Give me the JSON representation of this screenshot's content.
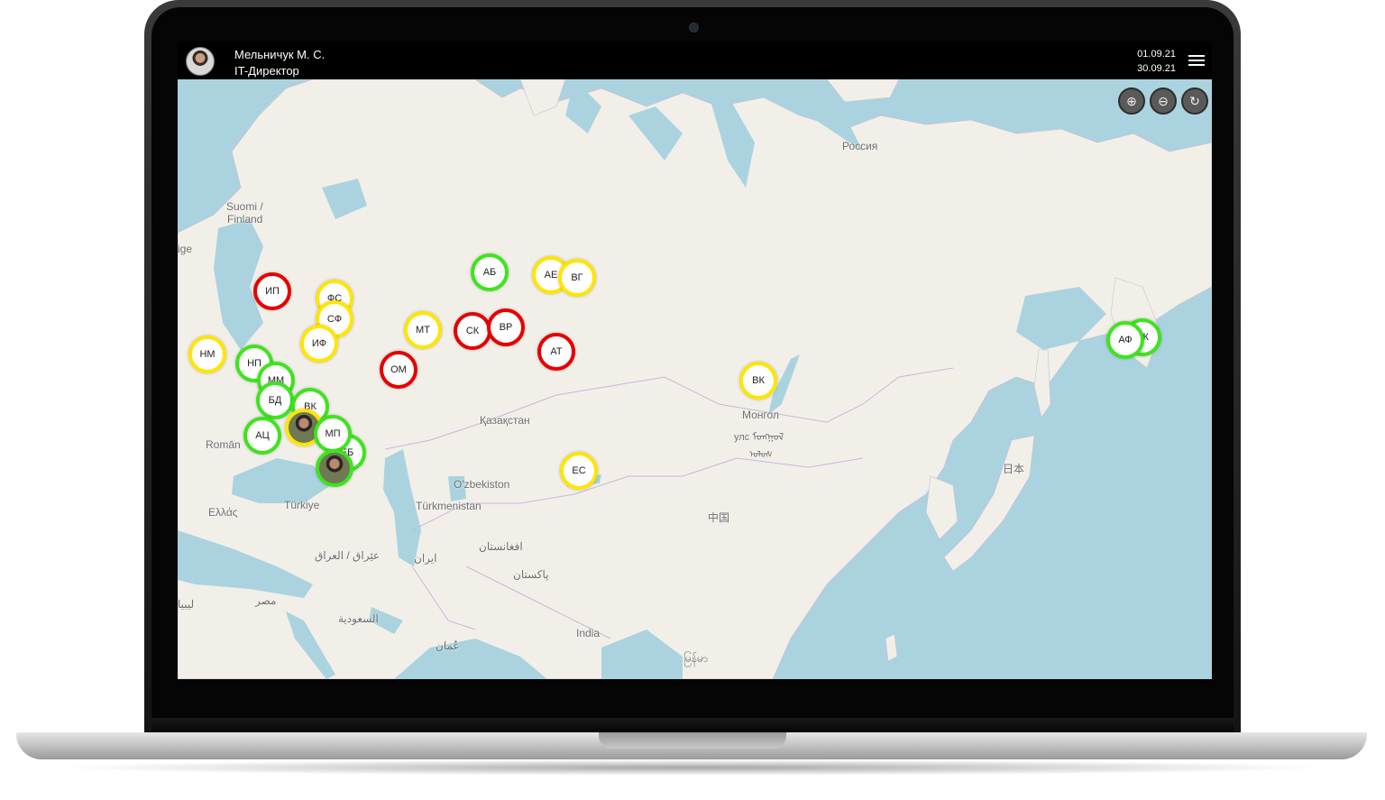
{
  "header": {
    "user_name": "Мельничук М. С.",
    "user_role": "IT-Директор",
    "date_from": "01.09.21",
    "date_to": "30.09.21"
  },
  "colors": {
    "status_red": "#e60000",
    "status_yellow": "#ffe500",
    "status_green": "#3ee41d",
    "topbar": "#000000",
    "water": "#aad3df",
    "land": "#f2efe9"
  },
  "map_controls": {
    "zoom_in_icon": "plus-circle-icon",
    "zoom_out_icon": "minus-circle-icon",
    "refresh_icon": "refresh-icon",
    "zoom_in": "⊕",
    "zoom_out": "⊖",
    "refresh": "↻"
  },
  "map_labels": [
    {
      "text": "Россия"
    },
    {
      "text": "Suomi /"
    },
    {
      "text": "Finland"
    },
    {
      "text": "ige"
    },
    {
      "text": "Romān"
    },
    {
      "text": "Ελλάς"
    },
    {
      "text": "Türkiye"
    },
    {
      "text": "Қазақстан"
    },
    {
      "text": "O'zbekiston"
    },
    {
      "text": "Türkmenistan"
    },
    {
      "text": "Монгол"
    },
    {
      "text": "улс ᠮᠣᠩᠭᠣᠯ"
    },
    {
      "text": "ᠤᠯᠤᠰ"
    },
    {
      "text": "中国"
    },
    {
      "text": "日本"
    },
    {
      "text": "عێراق / العراق"
    },
    {
      "text": "ایران"
    },
    {
      "text": "افغانستان"
    },
    {
      "text": "پاکستان"
    },
    {
      "text": "مصر"
    },
    {
      "text": "ليبيا"
    },
    {
      "text": "السعودية"
    },
    {
      "text": "عُمان"
    },
    {
      "text": "India"
    },
    {
      "text": "မြန်မာ"
    }
  ],
  "markers": [
    {
      "label": "ИП",
      "status": "red"
    },
    {
      "label": "ФС",
      "status": "yellow"
    },
    {
      "label": "СФ",
      "status": "yellow"
    },
    {
      "label": "ИФ",
      "status": "yellow"
    },
    {
      "label": "НМ",
      "status": "yellow"
    },
    {
      "label": "НП",
      "status": "green"
    },
    {
      "label": "ММ",
      "status": "green"
    },
    {
      "label": "БД",
      "status": "green"
    },
    {
      "label": "ВК",
      "status": "green"
    },
    {
      "label": "АЦ",
      "status": "green"
    },
    {
      "label": "",
      "status": "yellow",
      "photo": true
    },
    {
      "label": "МП",
      "status": "green"
    },
    {
      "label": "ЕБ",
      "status": "green"
    },
    {
      "label": "",
      "status": "green",
      "photo": true
    },
    {
      "label": "МТ",
      "status": "yellow"
    },
    {
      "label": "ОМ",
      "status": "red"
    },
    {
      "label": "СК",
      "status": "red"
    },
    {
      "label": "ВР",
      "status": "red"
    },
    {
      "label": "АБ",
      "status": "green"
    },
    {
      "label": "АЕ",
      "status": "yellow"
    },
    {
      "label": "ВГ",
      "status": "yellow"
    },
    {
      "label": "АТ",
      "status": "red"
    },
    {
      "label": "ЕС",
      "status": "yellow"
    },
    {
      "label": "ВК",
      "status": "yellow"
    },
    {
      "label": "ЕК",
      "status": "green"
    },
    {
      "label": "АФ",
      "status": "green"
    }
  ]
}
